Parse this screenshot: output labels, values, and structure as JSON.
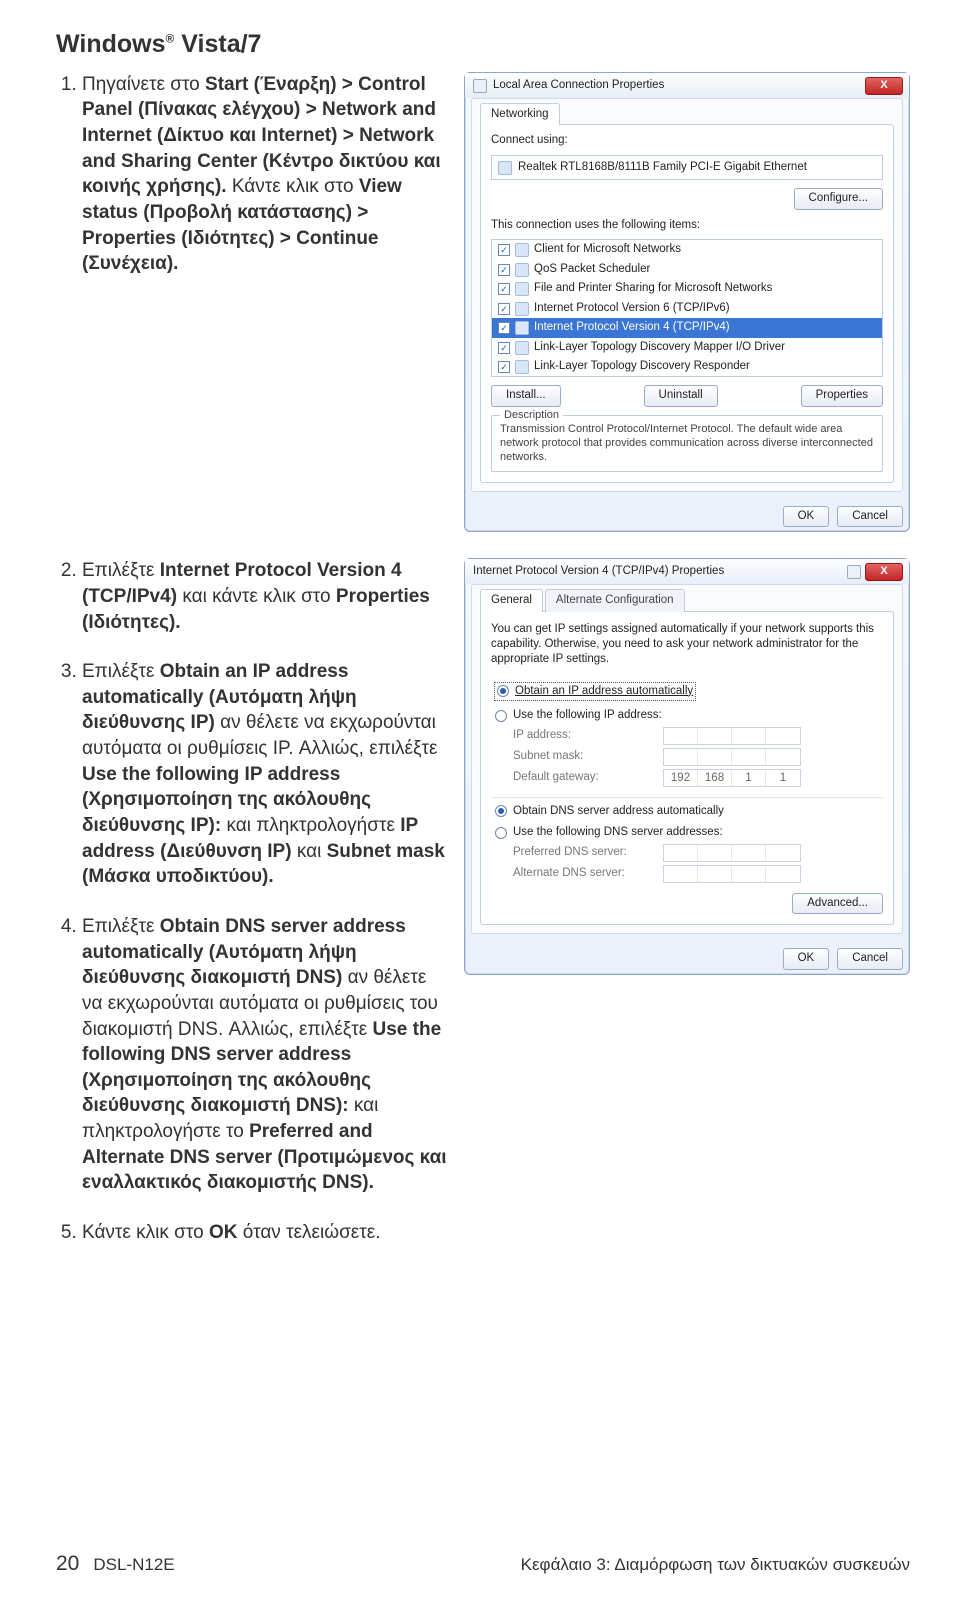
{
  "title_prefix": "Windows",
  "title_reg": "®",
  "title_suffix": " Vista/7",
  "steps": {
    "s1": {
      "a": "Πηγαίνετε στο ",
      "a_b": "Start (Έναρξη) > Control Panel (Πίνακας ελέγχου) > Network and Internet (Δίκτυο και Internet) > Network and Sharing Center (Κέντρο δικτύου και κοινής χρήσης).",
      "b": " Κάντε κλικ στο ",
      "b_b": "View status (Προβολή κατάστασης) > Properties (Ιδιότητες) > Continue (Συνέχεια)."
    },
    "s2": {
      "a": "Επιλέξτε ",
      "a_b": "Internet Protocol Version 4 (TCP/IPv4)",
      "b": " και κάντε κλικ στο ",
      "b_b": "Properties (Ιδιότητες)."
    },
    "s3": {
      "a": "Επιλέξτε ",
      "a_b": "Obtain an IP address automatically (Αυτόματη λήψη διεύθυνσης IP)",
      "b": " αν θέλετε να εκχωρούνται αυτόματα οι ρυθμίσεις IP. Αλλιώς, επιλέξτε ",
      "b_b": "Use the following IP address (Χρησιμοποίηση της ακόλουθης διεύθυνσης IP):",
      "c": " και πληκτρολογήστε ",
      "c_b": "IP address (Διεύθυνση IP)",
      "d": " και ",
      "d_b": "Subnet mask (Μάσκα υποδικτύου)."
    },
    "s4": {
      "a": "Επιλέξτε ",
      "a_b": "Obtain DNS server address automatically (Αυτόματη λήψη διεύθυνσης διακομιστή DNS)",
      "b": " αν θέλετε να εκχωρούνται αυτόματα οι ρυθμίσεις του διακομιστή DNS. Αλλιώς, επιλέξτε ",
      "b_b": "Use the following DNS server address (Χρησιμοποίηση της ακόλουθης διεύθυνσης διακομιστή DNS):",
      "c": " και πληκτρολογήστε το ",
      "c_b": "Preferred and Alternate DNS server (Προτιμώμενος και εναλλακτικός διακομιστής DNS)."
    },
    "s5": {
      "a": "Κάντε κλικ στο ",
      "a_b": "OK",
      "b": " όταν τελειώσετε."
    }
  },
  "dlg1": {
    "title": "Local Area Connection Properties",
    "tab": "Networking",
    "connect_using": "Connect using:",
    "adapter": "Realtek RTL8168B/8111B Family PCI-E Gigabit Ethernet",
    "configure": "Configure...",
    "uses": "This connection uses the following items:",
    "items": [
      "Client for Microsoft Networks",
      "QoS Packet Scheduler",
      "File and Printer Sharing for Microsoft Networks",
      "Internet Protocol Version 6 (TCP/IPv6)",
      "Internet Protocol Version 4 (TCP/IPv4)",
      "Link-Layer Topology Discovery Mapper I/O Driver",
      "Link-Layer Topology Discovery Responder"
    ],
    "install": "Install...",
    "uninstall": "Uninstall",
    "properties": "Properties",
    "desc_cap": "Description",
    "desc_text": "Transmission Control Protocol/Internet Protocol. The default wide area network protocol that provides communication across diverse interconnected networks.",
    "ok": "OK",
    "cancel": "Cancel",
    "close_x": "X"
  },
  "dlg2": {
    "title": "Internet Protocol Version 4 (TCP/IPv4) Properties",
    "tab_general": "General",
    "tab_alt": "Alternate Configuration",
    "intro": "You can get IP settings assigned automatically if your network supports this capability. Otherwise, you need to ask your network administrator for the appropriate IP settings.",
    "r1": "Obtain an IP address automatically",
    "r2": "Use the following IP address:",
    "ip_label": "IP address:",
    "subnet_label": "Subnet mask:",
    "gw_label": "Default gateway:",
    "gw": [
      "192",
      "168",
      "1",
      "1"
    ],
    "r3": "Obtain DNS server address automatically",
    "r4": "Use the following DNS server addresses:",
    "pref_dns": "Preferred DNS server:",
    "alt_dns": "Alternate DNS server:",
    "advanced": "Advanced...",
    "ok": "OK",
    "cancel": "Cancel",
    "close_x": "X"
  },
  "footer": {
    "page": "20",
    "model": "DSL-N12E",
    "chapter": "Κεφάλαιο 3: Διαμόρφωση των δικτυακών συσκευών"
  }
}
